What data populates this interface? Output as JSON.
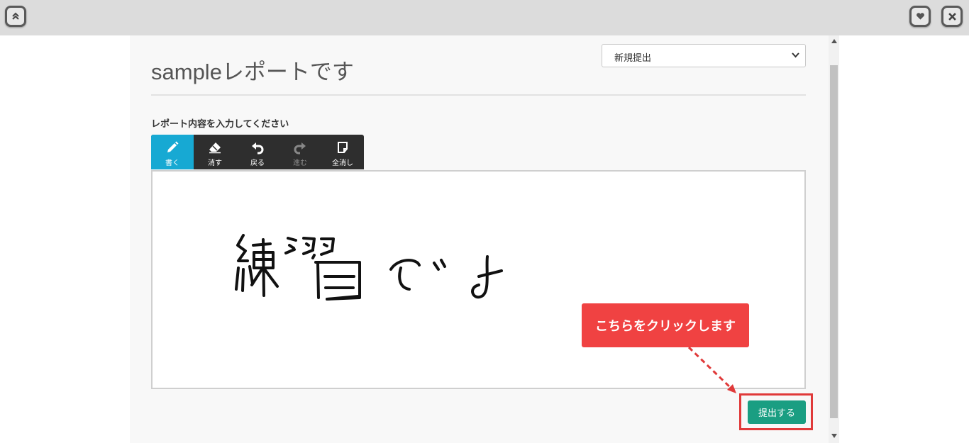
{
  "window": {
    "top_left_icon": "double-chevron-up-icon",
    "favorite_icon": "heart-icon",
    "close_icon": "close-icon"
  },
  "report": {
    "title": "sampleレポートです",
    "select_value": "新規提出",
    "content_label": "レポート内容を入力してください",
    "handwriting_text": "練習です"
  },
  "toolbar": {
    "tools": [
      {
        "label": "書く",
        "icon": "pencil-icon",
        "state": "active"
      },
      {
        "label": "消す",
        "icon": "eraser-icon",
        "state": "normal"
      },
      {
        "label": "戻る",
        "icon": "undo-icon",
        "state": "normal"
      },
      {
        "label": "進む",
        "icon": "redo-icon",
        "state": "disabled"
      },
      {
        "label": "全消し",
        "icon": "clear-page-icon",
        "state": "normal"
      }
    ]
  },
  "annotation": {
    "callout_text": "こちらをクリックします"
  },
  "actions": {
    "submit_label": "提出する"
  },
  "colors": {
    "active_tool": "#17a9d3",
    "toolbar_bg": "#2e2e2e",
    "submit_button": "#1a9e82",
    "callout": "#f04242"
  }
}
